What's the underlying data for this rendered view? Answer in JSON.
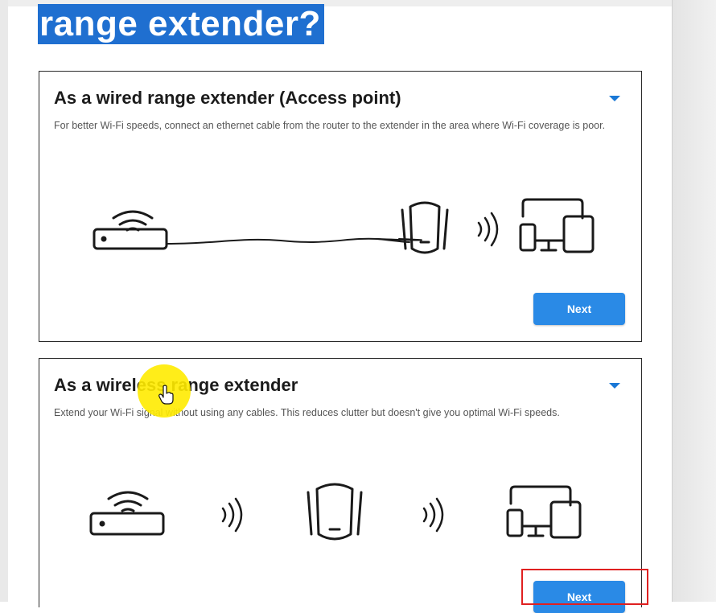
{
  "page": {
    "heading": "range extender?"
  },
  "cards": [
    {
      "title": "As a wired range extender (Access point)",
      "description": "For better Wi-Fi speeds, connect an ethernet cable from the router to the extender in the area where Wi-Fi coverage is poor.",
      "next_label": "Next",
      "expand_icon": "chevron-down-icon"
    },
    {
      "title": "As a wireless range extender",
      "description": "Extend your Wi-Fi signal without using any cables. This reduces clutter but doesn't give you optimal Wi-Fi speeds.",
      "next_label": "Next",
      "expand_icon": "chevron-down-icon"
    }
  ],
  "colors": {
    "heading_highlight": "#1f6fd0",
    "button": "#2a8ae6",
    "chevron": "#1a78d6",
    "annotation_box": "#e02020",
    "cursor_highlight": "#ffeb00"
  }
}
